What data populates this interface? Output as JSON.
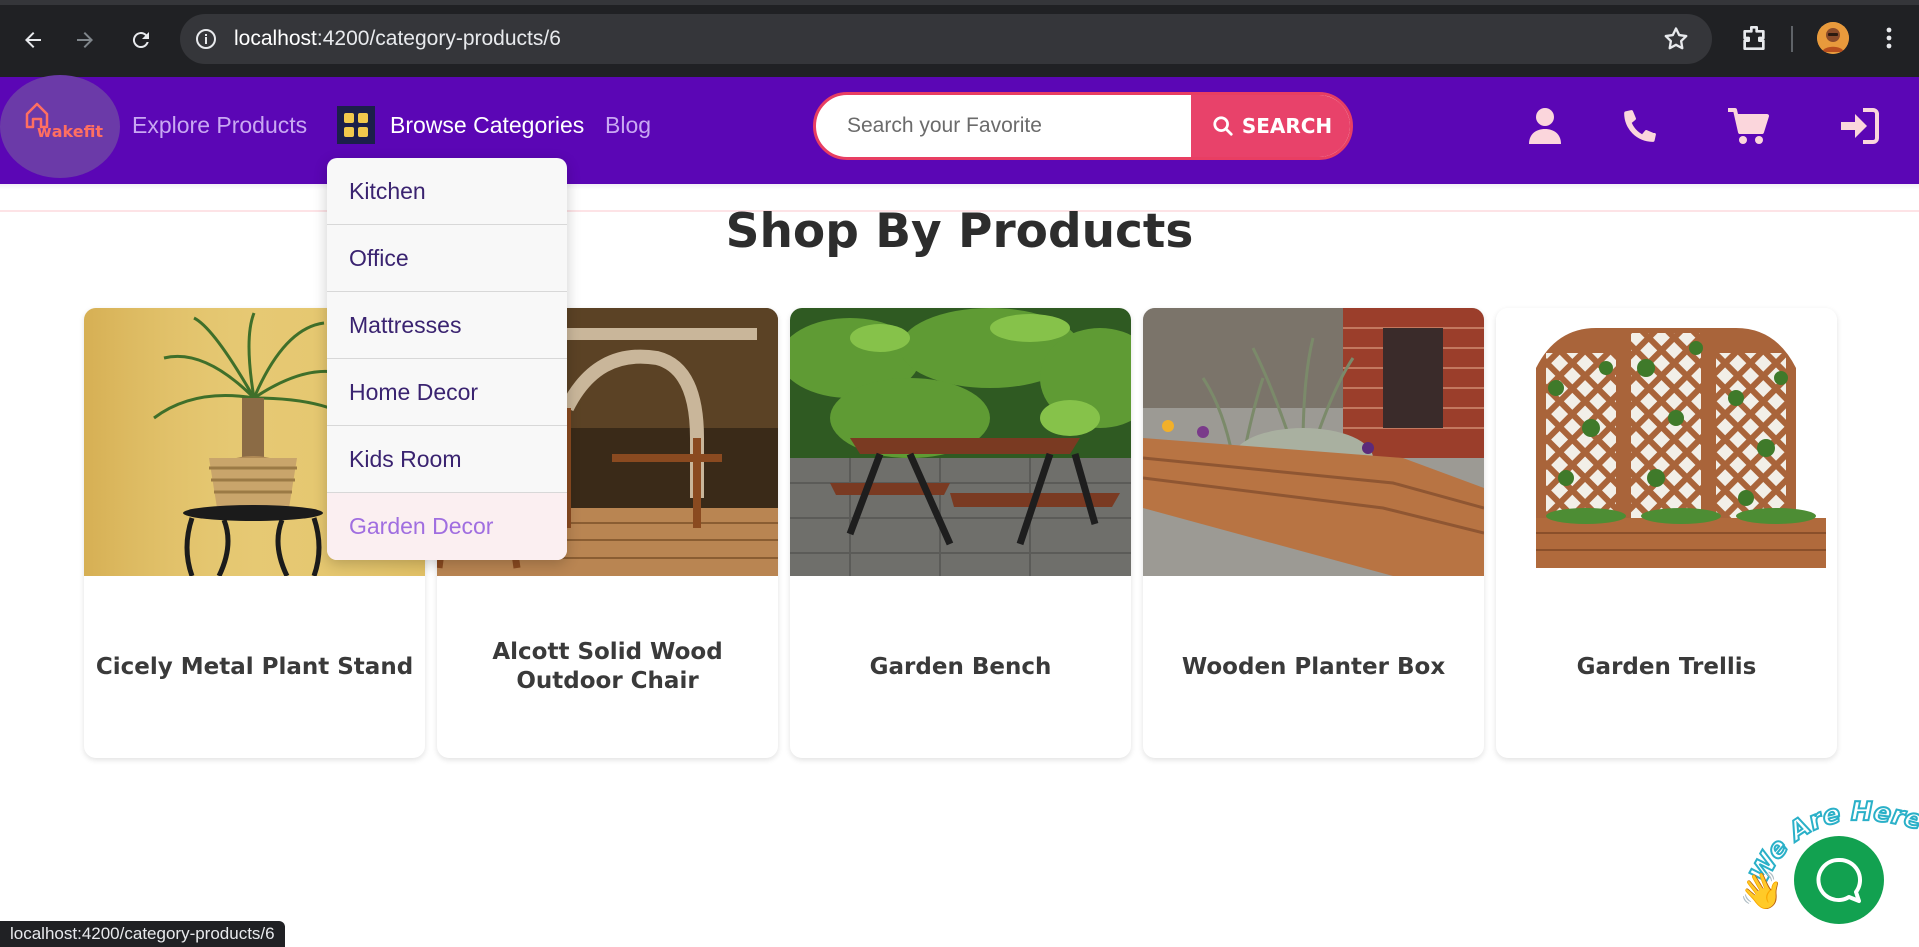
{
  "browser": {
    "url_host": "localhost",
    "url_path": ":4200/category-products/6",
    "status_url": "localhost:4200/category-products/6"
  },
  "site": {
    "logo_text": "wakefit",
    "nav": {
      "explore": "Explore Products",
      "browse": "Browse Categories",
      "blog": "Blog"
    },
    "search": {
      "placeholder": "Search your Favorite",
      "button": "SEARCH"
    },
    "icons": [
      "user-icon",
      "phone-icon",
      "cart-icon",
      "sign-in-icon"
    ]
  },
  "dropdown": {
    "items": [
      "Kitchen",
      "Office",
      "Mattresses",
      "Home Decor",
      "Kids Room",
      "Garden Decor"
    ]
  },
  "main": {
    "heading": "Shop By Products",
    "products": [
      {
        "title": "Cicely Metal Plant Stand"
      },
      {
        "title": "Alcott Solid Wood Outdoor Chair"
      },
      {
        "title": "Garden Bench"
      },
      {
        "title": "Wooden Planter Box"
      },
      {
        "title": "Garden Trellis"
      }
    ]
  },
  "chat": {
    "badge_text": "We Are Here!"
  },
  "colors": {
    "navbar": "#5b06b5",
    "accent": "#e8426a",
    "chat": "#12a150"
  }
}
